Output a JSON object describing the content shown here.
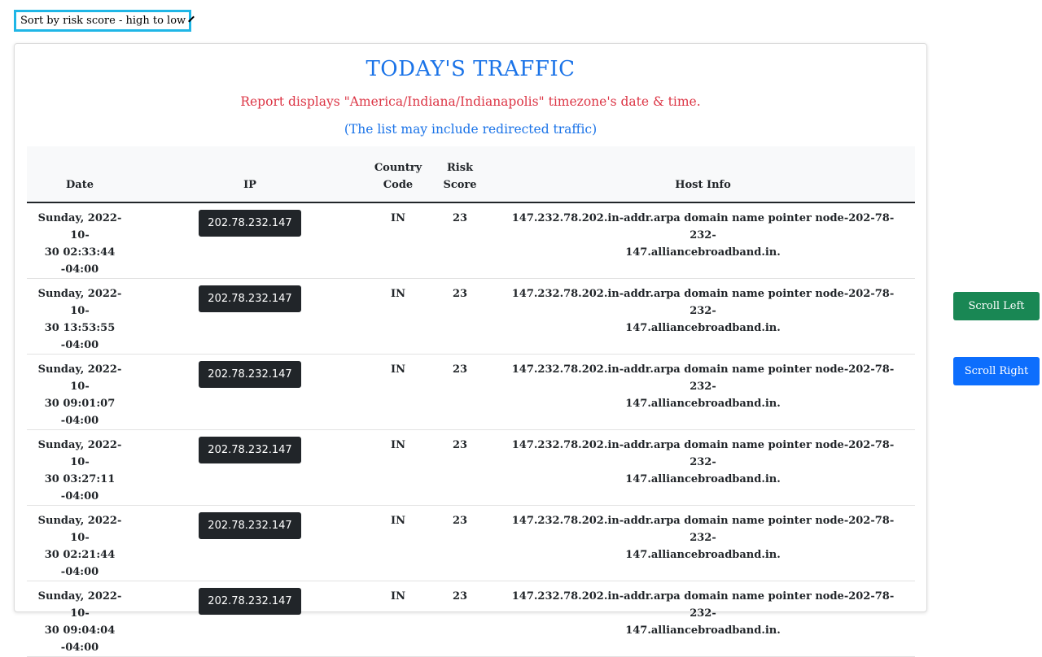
{
  "sort": {
    "selected": "Sort by risk score - high to low"
  },
  "report": {
    "title": "TODAY'S TRAFFIC",
    "timezone_note": "Report displays \"America/Indiana/Indianapolis\" timezone's date & time.",
    "redirect_note": "(The list may include redirected traffic)"
  },
  "table": {
    "headers": {
      "date": "Date",
      "ip": "IP",
      "country_code_1": "Country",
      "country_code_2": "Code",
      "risk_score_1": "Risk",
      "risk_score_2": "Score",
      "host_info": "Host Info"
    },
    "rows": [
      {
        "date_1": "Sunday, 2022-10-",
        "date_2": "30 02:33:44",
        "date_3": "-04:00",
        "ip": "202.78.232.147",
        "country": "IN",
        "risk": "23",
        "host_1": "147.232.78.202.in-addr.arpa domain name pointer node-202-78-232-",
        "host_2": "147.alliancebroadband.in."
      },
      {
        "date_1": "Sunday, 2022-10-",
        "date_2": "30 13:53:55",
        "date_3": "-04:00",
        "ip": "202.78.232.147",
        "country": "IN",
        "risk": "23",
        "host_1": "147.232.78.202.in-addr.arpa domain name pointer node-202-78-232-",
        "host_2": "147.alliancebroadband.in."
      },
      {
        "date_1": "Sunday, 2022-10-",
        "date_2": "30 09:01:07",
        "date_3": "-04:00",
        "ip": "202.78.232.147",
        "country": "IN",
        "risk": "23",
        "host_1": "147.232.78.202.in-addr.arpa domain name pointer node-202-78-232-",
        "host_2": "147.alliancebroadband.in."
      },
      {
        "date_1": "Sunday, 2022-10-",
        "date_2": "30 03:27:11",
        "date_3": "-04:00",
        "ip": "202.78.232.147",
        "country": "IN",
        "risk": "23",
        "host_1": "147.232.78.202.in-addr.arpa domain name pointer node-202-78-232-",
        "host_2": "147.alliancebroadband.in."
      },
      {
        "date_1": "Sunday, 2022-10-",
        "date_2": "30 02:21:44",
        "date_3": "-04:00",
        "ip": "202.78.232.147",
        "country": "IN",
        "risk": "23",
        "host_1": "147.232.78.202.in-addr.arpa domain name pointer node-202-78-232-",
        "host_2": "147.alliancebroadband.in."
      },
      {
        "date_1": "Sunday, 2022-10-",
        "date_2": "30 09:04:04",
        "date_3": "-04:00",
        "ip": "202.78.232.147",
        "country": "IN",
        "risk": "23",
        "host_1": "147.232.78.202.in-addr.arpa domain name pointer node-202-78-232-",
        "host_2": "147.alliancebroadband.in."
      }
    ]
  },
  "buttons": {
    "scroll_left": "Scroll Left",
    "scroll_right": "Scroll Right"
  },
  "colors": {
    "title": "#1a73e8",
    "timezone_note": "#dc3545",
    "scroll_left_bg": "#198754",
    "scroll_right_bg": "#0d6efd",
    "ip_badge_bg": "#212529",
    "select_focus_border": "#1fb6e6"
  },
  "icons": {
    "select_caret": "chevron-down-icon"
  }
}
